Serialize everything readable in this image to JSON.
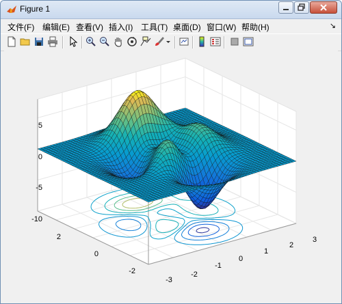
{
  "window": {
    "title": "Figure 1"
  },
  "menu": [
    {
      "label": "文件(F)"
    },
    {
      "label": "编辑(E)"
    },
    {
      "label": "查看(V)"
    },
    {
      "label": "插入(I)"
    },
    {
      "label": "工具(T)"
    },
    {
      "label": "桌面(D)"
    },
    {
      "label": "窗口(W)"
    },
    {
      "label": "帮助(H)"
    }
  ],
  "menu_overflow": "↘",
  "toolbar": [
    {
      "icon": "new-file-icon"
    },
    {
      "icon": "open-folder-icon"
    },
    {
      "icon": "save-icon"
    },
    {
      "icon": "print-icon"
    },
    {
      "icon": "pointer-icon"
    },
    {
      "icon": "zoom-in-icon"
    },
    {
      "icon": "zoom-out-icon"
    },
    {
      "icon": "pan-hand-icon"
    },
    {
      "icon": "rotate-3d-icon"
    },
    {
      "icon": "data-cursor-icon"
    },
    {
      "icon": "brush-icon"
    },
    {
      "icon": "link-plot-icon"
    },
    {
      "icon": "colorbar-icon"
    },
    {
      "icon": "legend-icon"
    },
    {
      "icon": "hide-plot-tools-icon"
    },
    {
      "icon": "show-plot-tools-icon"
    }
  ],
  "axes": {
    "z_ticks": [
      "5",
      "0",
      "-5",
      "-10"
    ],
    "y_ticks": [
      "2",
      "0",
      "-2"
    ],
    "x_ticks": [
      "-3",
      "-2",
      "-1",
      "0",
      "1",
      "2",
      "3"
    ]
  },
  "chart_data": {
    "type": "surface",
    "function": "peaks",
    "x_range": [
      -3,
      3
    ],
    "y_range": [
      -3,
      3
    ],
    "z_range": [
      -10,
      8
    ],
    "colormap": "parula",
    "contour_plane_z": -10,
    "grid": true
  }
}
